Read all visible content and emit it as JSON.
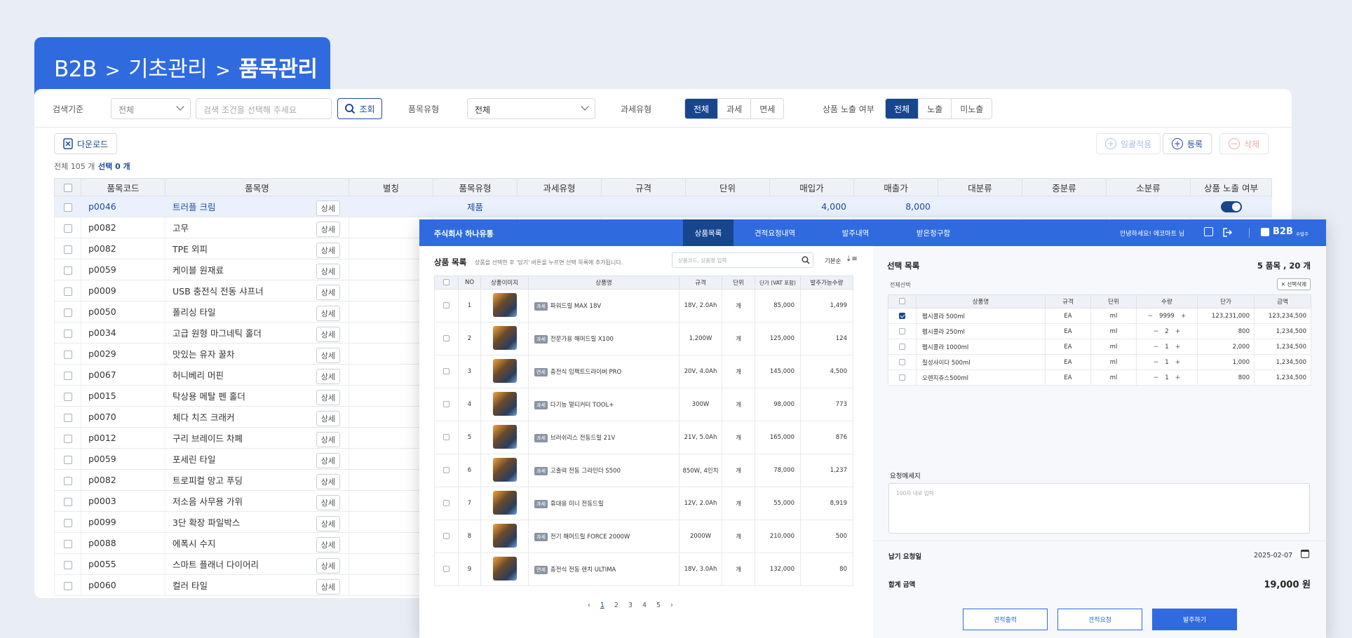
{
  "breadcrumb": {
    "root": "B2B",
    "parent": "기초관리",
    "current": "품목관리",
    "sep": ">"
  },
  "filters": {
    "criteria_label": "검색기준",
    "criteria_value": "전체",
    "search_placeholder": "검색 조건을 선택해 주세요",
    "search_button": "조회",
    "type_label": "품목유형",
    "type_value": "전체",
    "tax_label": "과세유형",
    "tax_options": [
      "전체",
      "과세",
      "면세"
    ],
    "expose_label": "상품 노출 여부",
    "expose_options": [
      "전체",
      "노출",
      "미노출"
    ]
  },
  "toolbar": {
    "download": "다운로드",
    "bulk_apply": "일괄적용",
    "register": "등록",
    "delete": "삭제"
  },
  "summary": {
    "total": "전체 105 개",
    "selected": "선택 0 개"
  },
  "table": {
    "columns": [
      "품목코드",
      "품목명",
      "별칭",
      "품목유형",
      "과세유형",
      "규격",
      "단위",
      "매입가",
      "매출가",
      "대분류",
      "중분류",
      "소분류",
      "상품 노출 여부"
    ],
    "detail_label": "상세",
    "first_row": {
      "type": "제품",
      "buy": "4,000",
      "sell": "8,000"
    },
    "rows": [
      {
        "code": "p0046",
        "name": "트러플 크림"
      },
      {
        "code": "p0082",
        "name": "고무"
      },
      {
        "code": "p0082",
        "name": "TPE 외피"
      },
      {
        "code": "p0059",
        "name": "케이블 원재료"
      },
      {
        "code": "p0009",
        "name": "USB 충전식 전동 샤프너"
      },
      {
        "code": "p0050",
        "name": "폴리싱 타일"
      },
      {
        "code": "p0034",
        "name": "고급 원형 마그네틱 홀더"
      },
      {
        "code": "p0029",
        "name": "맛있는 유자 꿀차"
      },
      {
        "code": "p0067",
        "name": "허니베리 머핀"
      },
      {
        "code": "p0015",
        "name": "탁상용 메탈 펜 홀더"
      },
      {
        "code": "p0070",
        "name": "체다 치즈 크래커"
      },
      {
        "code": "p0012",
        "name": "구리 브레이드 차폐"
      },
      {
        "code": "p0059",
        "name": "포세린 타일"
      },
      {
        "code": "p0082",
        "name": "트로피컬 망고 푸딩"
      },
      {
        "code": "p0003",
        "name": "저소음 사무용 가위"
      },
      {
        "code": "p0099",
        "name": "3단 확장 파일박스"
      },
      {
        "code": "p0088",
        "name": "에폭시 수지"
      },
      {
        "code": "p0055",
        "name": "스마트 플래너 다이어리"
      },
      {
        "code": "p0060",
        "name": "컬러 타일"
      }
    ]
  },
  "overlay": {
    "company": "주식회사 하나유통",
    "tabs": [
      "상품목록",
      "견적요청내역",
      "발주내역",
      "받은청구함"
    ],
    "greeting": "안녕하세요! 에코마트 님",
    "logo": "B2B",
    "logo_sub": "수발주",
    "product_list": {
      "title": "상품 목록",
      "hint": "상품을 선택한 후 '담기' 버튼을 누르면 선택 목록에 추가됩니다.",
      "search_placeholder": "상품코드, 상품명 입력",
      "sort": "기본순",
      "columns": [
        "NO",
        "상품이미지",
        "상품명",
        "규격",
        "단위",
        "단가 (VAT 포함)",
        "발주가능수량"
      ],
      "rows": [
        {
          "no": "1",
          "tag": "과세",
          "name": "파워드릴 MAX 18V",
          "spec": "18V, 2.0Ah",
          "unit": "개",
          "price": "85,000",
          "qty": "1,499"
        },
        {
          "no": "2",
          "tag": "과세",
          "name": "전문가용 해머드릴 X100",
          "spec": "1,200W",
          "unit": "개",
          "price": "125,000",
          "qty": "124"
        },
        {
          "no": "3",
          "tag": "면세",
          "name": "충전식 임팩트드라이버 PRO",
          "spec": "20V, 4.0Ah",
          "unit": "개",
          "price": "145,000",
          "qty": "4,500"
        },
        {
          "no": "4",
          "tag": "과세",
          "name": "다기능 멀티커터 TOOL+",
          "spec": "300W",
          "unit": "개",
          "price": "98,000",
          "qty": "773"
        },
        {
          "no": "5",
          "tag": "과세",
          "name": "브러쉬리스 전동드릴 21V",
          "spec": "21V, 5.0Ah",
          "unit": "개",
          "price": "165,000",
          "qty": "876"
        },
        {
          "no": "6",
          "tag": "과세",
          "name": "고출력 전동 그라인더 S500",
          "spec": "850W, 4인치",
          "unit": "개",
          "price": "78,000",
          "qty": "1,237"
        },
        {
          "no": "7",
          "tag": "과세",
          "name": "휴대용 미니 전동드릴",
          "spec": "12V, 2.0Ah",
          "unit": "개",
          "price": "55,000",
          "qty": "8,919"
        },
        {
          "no": "8",
          "tag": "과세",
          "name": "전기 해머드릴 FORCE 2000W",
          "spec": "2000W",
          "unit": "개",
          "price": "210,000",
          "qty": "500"
        },
        {
          "no": "9",
          "tag": "면세",
          "name": "충전식 전동 렌치 ULTIMA",
          "spec": "18V, 3.0Ah",
          "unit": "개",
          "price": "132,000",
          "qty": "80"
        }
      ],
      "pages": [
        "1",
        "2",
        "3",
        "4",
        "5"
      ],
      "current_page": "1"
    },
    "selected": {
      "title": "선택 목록",
      "count": "5 품목 , 20 개",
      "select_all": "전체선택",
      "delete_selected": "선택삭제",
      "columns": [
        "상품명",
        "규격",
        "단위",
        "수량",
        "단가",
        "금액"
      ],
      "rows": [
        {
          "name": "펩시콜라 500ml",
          "spec": "EA",
          "unit": "ml",
          "qty": "9999",
          "price": "123,231,000",
          "amount": "123,234,500",
          "checked": true
        },
        {
          "name": "펩시콜라 250ml",
          "spec": "EA",
          "unit": "ml",
          "qty": "2",
          "price": "800",
          "amount": "1,234,500",
          "checked": false
        },
        {
          "name": "펩시콜라 1000ml",
          "spec": "EA",
          "unit": "ml",
          "qty": "1",
          "price": "2,000",
          "amount": "1,234,500",
          "checked": false
        },
        {
          "name": "칠성사이다 500ml",
          "spec": "EA",
          "unit": "ml",
          "qty": "1",
          "price": "1,000",
          "amount": "1,234,500",
          "checked": false
        },
        {
          "name": "오렌지쥬스500ml",
          "spec": "EA",
          "unit": "ml",
          "qty": "1",
          "price": "800",
          "amount": "1,234,500",
          "checked": false
        }
      ],
      "minus": "−",
      "plus": "+"
    },
    "request": {
      "label": "요청메세지",
      "placeholder": "100자 내로 입력"
    },
    "delivery": {
      "label": "납기 요청일",
      "value": "2025-02-07"
    },
    "total": {
      "label": "합계 금액",
      "value": "19,000 원"
    },
    "buttons": {
      "print": "견적출력",
      "request": "견적요청",
      "order": "발주하기"
    }
  },
  "colors": {
    "primary": "#2f6bdf",
    "navy": "#17468f",
    "background": "#e9edf5"
  }
}
